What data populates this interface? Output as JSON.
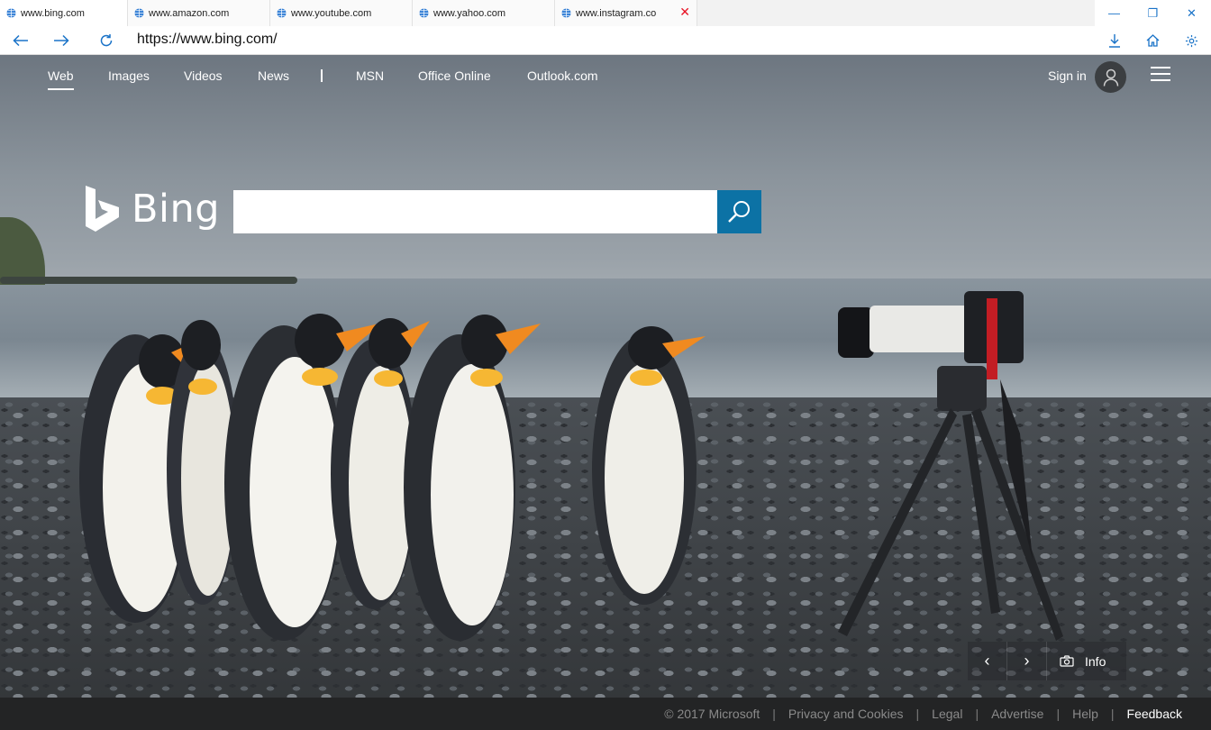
{
  "tabs": [
    {
      "title": "www.bing.com"
    },
    {
      "title": "www.amazon.com"
    },
    {
      "title": "www.youtube.com"
    },
    {
      "title": "www.yahoo.com"
    },
    {
      "title": "www.instagram.co",
      "closable": true
    }
  ],
  "window_controls": {
    "minimize": "—",
    "restore": "❐",
    "close": "✕"
  },
  "address_bar": {
    "url": "https://www.bing.com/"
  },
  "bing": {
    "nav": [
      "Web",
      "Images",
      "Videos",
      "News",
      "MSN",
      "Office Online",
      "Outlook.com"
    ],
    "active_nav": "Web",
    "sign_in": "Sign in",
    "logo_text": "Bing",
    "search_placeholder": "",
    "search_value": ""
  },
  "carousel": {
    "prev": "‹",
    "next": "›",
    "info": "Info"
  },
  "footer": {
    "copyright": "© 2017 Microsoft",
    "links": [
      "Privacy and Cookies",
      "Legal",
      "Advertise",
      "Help"
    ],
    "feedback": "Feedback"
  },
  "colors": {
    "accent": "#0c72a5",
    "footer_bg": "#232425",
    "link_blue": "#1a73c8"
  },
  "icons": [
    "globe-icon",
    "back-arrow-icon",
    "forward-arrow-icon",
    "refresh-icon",
    "download-icon",
    "home-icon",
    "gear-icon",
    "search-icon",
    "user-icon",
    "hamburger-icon",
    "camera-icon"
  ]
}
